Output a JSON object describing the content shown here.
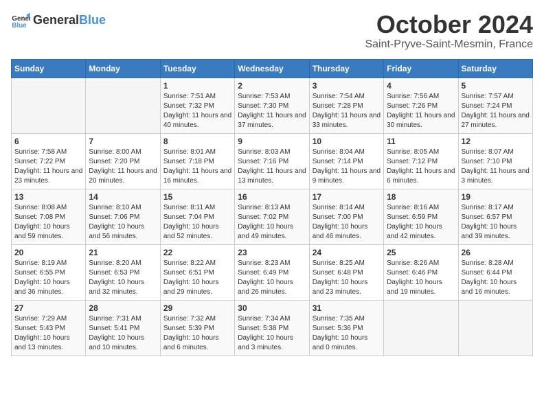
{
  "header": {
    "logo_general": "General",
    "logo_blue": "Blue",
    "month_title": "October 2024",
    "location": "Saint-Pryve-Saint-Mesmin, France"
  },
  "days_of_week": [
    "Sunday",
    "Monday",
    "Tuesday",
    "Wednesday",
    "Thursday",
    "Friday",
    "Saturday"
  ],
  "weeks": [
    [
      {
        "day": "",
        "info": ""
      },
      {
        "day": "",
        "info": ""
      },
      {
        "day": "1",
        "info": "Sunrise: 7:51 AM\nSunset: 7:32 PM\nDaylight: 11 hours and 40 minutes."
      },
      {
        "day": "2",
        "info": "Sunrise: 7:53 AM\nSunset: 7:30 PM\nDaylight: 11 hours and 37 minutes."
      },
      {
        "day": "3",
        "info": "Sunrise: 7:54 AM\nSunset: 7:28 PM\nDaylight: 11 hours and 33 minutes."
      },
      {
        "day": "4",
        "info": "Sunrise: 7:56 AM\nSunset: 7:26 PM\nDaylight: 11 hours and 30 minutes."
      },
      {
        "day": "5",
        "info": "Sunrise: 7:57 AM\nSunset: 7:24 PM\nDaylight: 11 hours and 27 minutes."
      }
    ],
    [
      {
        "day": "6",
        "info": "Sunrise: 7:58 AM\nSunset: 7:22 PM\nDaylight: 11 hours and 23 minutes."
      },
      {
        "day": "7",
        "info": "Sunrise: 8:00 AM\nSunset: 7:20 PM\nDaylight: 11 hours and 20 minutes."
      },
      {
        "day": "8",
        "info": "Sunrise: 8:01 AM\nSunset: 7:18 PM\nDaylight: 11 hours and 16 minutes."
      },
      {
        "day": "9",
        "info": "Sunrise: 8:03 AM\nSunset: 7:16 PM\nDaylight: 11 hours and 13 minutes."
      },
      {
        "day": "10",
        "info": "Sunrise: 8:04 AM\nSunset: 7:14 PM\nDaylight: 11 hours and 9 minutes."
      },
      {
        "day": "11",
        "info": "Sunrise: 8:05 AM\nSunset: 7:12 PM\nDaylight: 11 hours and 6 minutes."
      },
      {
        "day": "12",
        "info": "Sunrise: 8:07 AM\nSunset: 7:10 PM\nDaylight: 11 hours and 3 minutes."
      }
    ],
    [
      {
        "day": "13",
        "info": "Sunrise: 8:08 AM\nSunset: 7:08 PM\nDaylight: 10 hours and 59 minutes."
      },
      {
        "day": "14",
        "info": "Sunrise: 8:10 AM\nSunset: 7:06 PM\nDaylight: 10 hours and 56 minutes."
      },
      {
        "day": "15",
        "info": "Sunrise: 8:11 AM\nSunset: 7:04 PM\nDaylight: 10 hours and 52 minutes."
      },
      {
        "day": "16",
        "info": "Sunrise: 8:13 AM\nSunset: 7:02 PM\nDaylight: 10 hours and 49 minutes."
      },
      {
        "day": "17",
        "info": "Sunrise: 8:14 AM\nSunset: 7:00 PM\nDaylight: 10 hours and 46 minutes."
      },
      {
        "day": "18",
        "info": "Sunrise: 8:16 AM\nSunset: 6:59 PM\nDaylight: 10 hours and 42 minutes."
      },
      {
        "day": "19",
        "info": "Sunrise: 8:17 AM\nSunset: 6:57 PM\nDaylight: 10 hours and 39 minutes."
      }
    ],
    [
      {
        "day": "20",
        "info": "Sunrise: 8:19 AM\nSunset: 6:55 PM\nDaylight: 10 hours and 36 minutes."
      },
      {
        "day": "21",
        "info": "Sunrise: 8:20 AM\nSunset: 6:53 PM\nDaylight: 10 hours and 32 minutes."
      },
      {
        "day": "22",
        "info": "Sunrise: 8:22 AM\nSunset: 6:51 PM\nDaylight: 10 hours and 29 minutes."
      },
      {
        "day": "23",
        "info": "Sunrise: 8:23 AM\nSunset: 6:49 PM\nDaylight: 10 hours and 26 minutes."
      },
      {
        "day": "24",
        "info": "Sunrise: 8:25 AM\nSunset: 6:48 PM\nDaylight: 10 hours and 23 minutes."
      },
      {
        "day": "25",
        "info": "Sunrise: 8:26 AM\nSunset: 6:46 PM\nDaylight: 10 hours and 19 minutes."
      },
      {
        "day": "26",
        "info": "Sunrise: 8:28 AM\nSunset: 6:44 PM\nDaylight: 10 hours and 16 minutes."
      }
    ],
    [
      {
        "day": "27",
        "info": "Sunrise: 7:29 AM\nSunset: 5:43 PM\nDaylight: 10 hours and 13 minutes."
      },
      {
        "day": "28",
        "info": "Sunrise: 7:31 AM\nSunset: 5:41 PM\nDaylight: 10 hours and 10 minutes."
      },
      {
        "day": "29",
        "info": "Sunrise: 7:32 AM\nSunset: 5:39 PM\nDaylight: 10 hours and 6 minutes."
      },
      {
        "day": "30",
        "info": "Sunrise: 7:34 AM\nSunset: 5:38 PM\nDaylight: 10 hours and 3 minutes."
      },
      {
        "day": "31",
        "info": "Sunrise: 7:35 AM\nSunset: 5:36 PM\nDaylight: 10 hours and 0 minutes."
      },
      {
        "day": "",
        "info": ""
      },
      {
        "day": "",
        "info": ""
      }
    ]
  ]
}
